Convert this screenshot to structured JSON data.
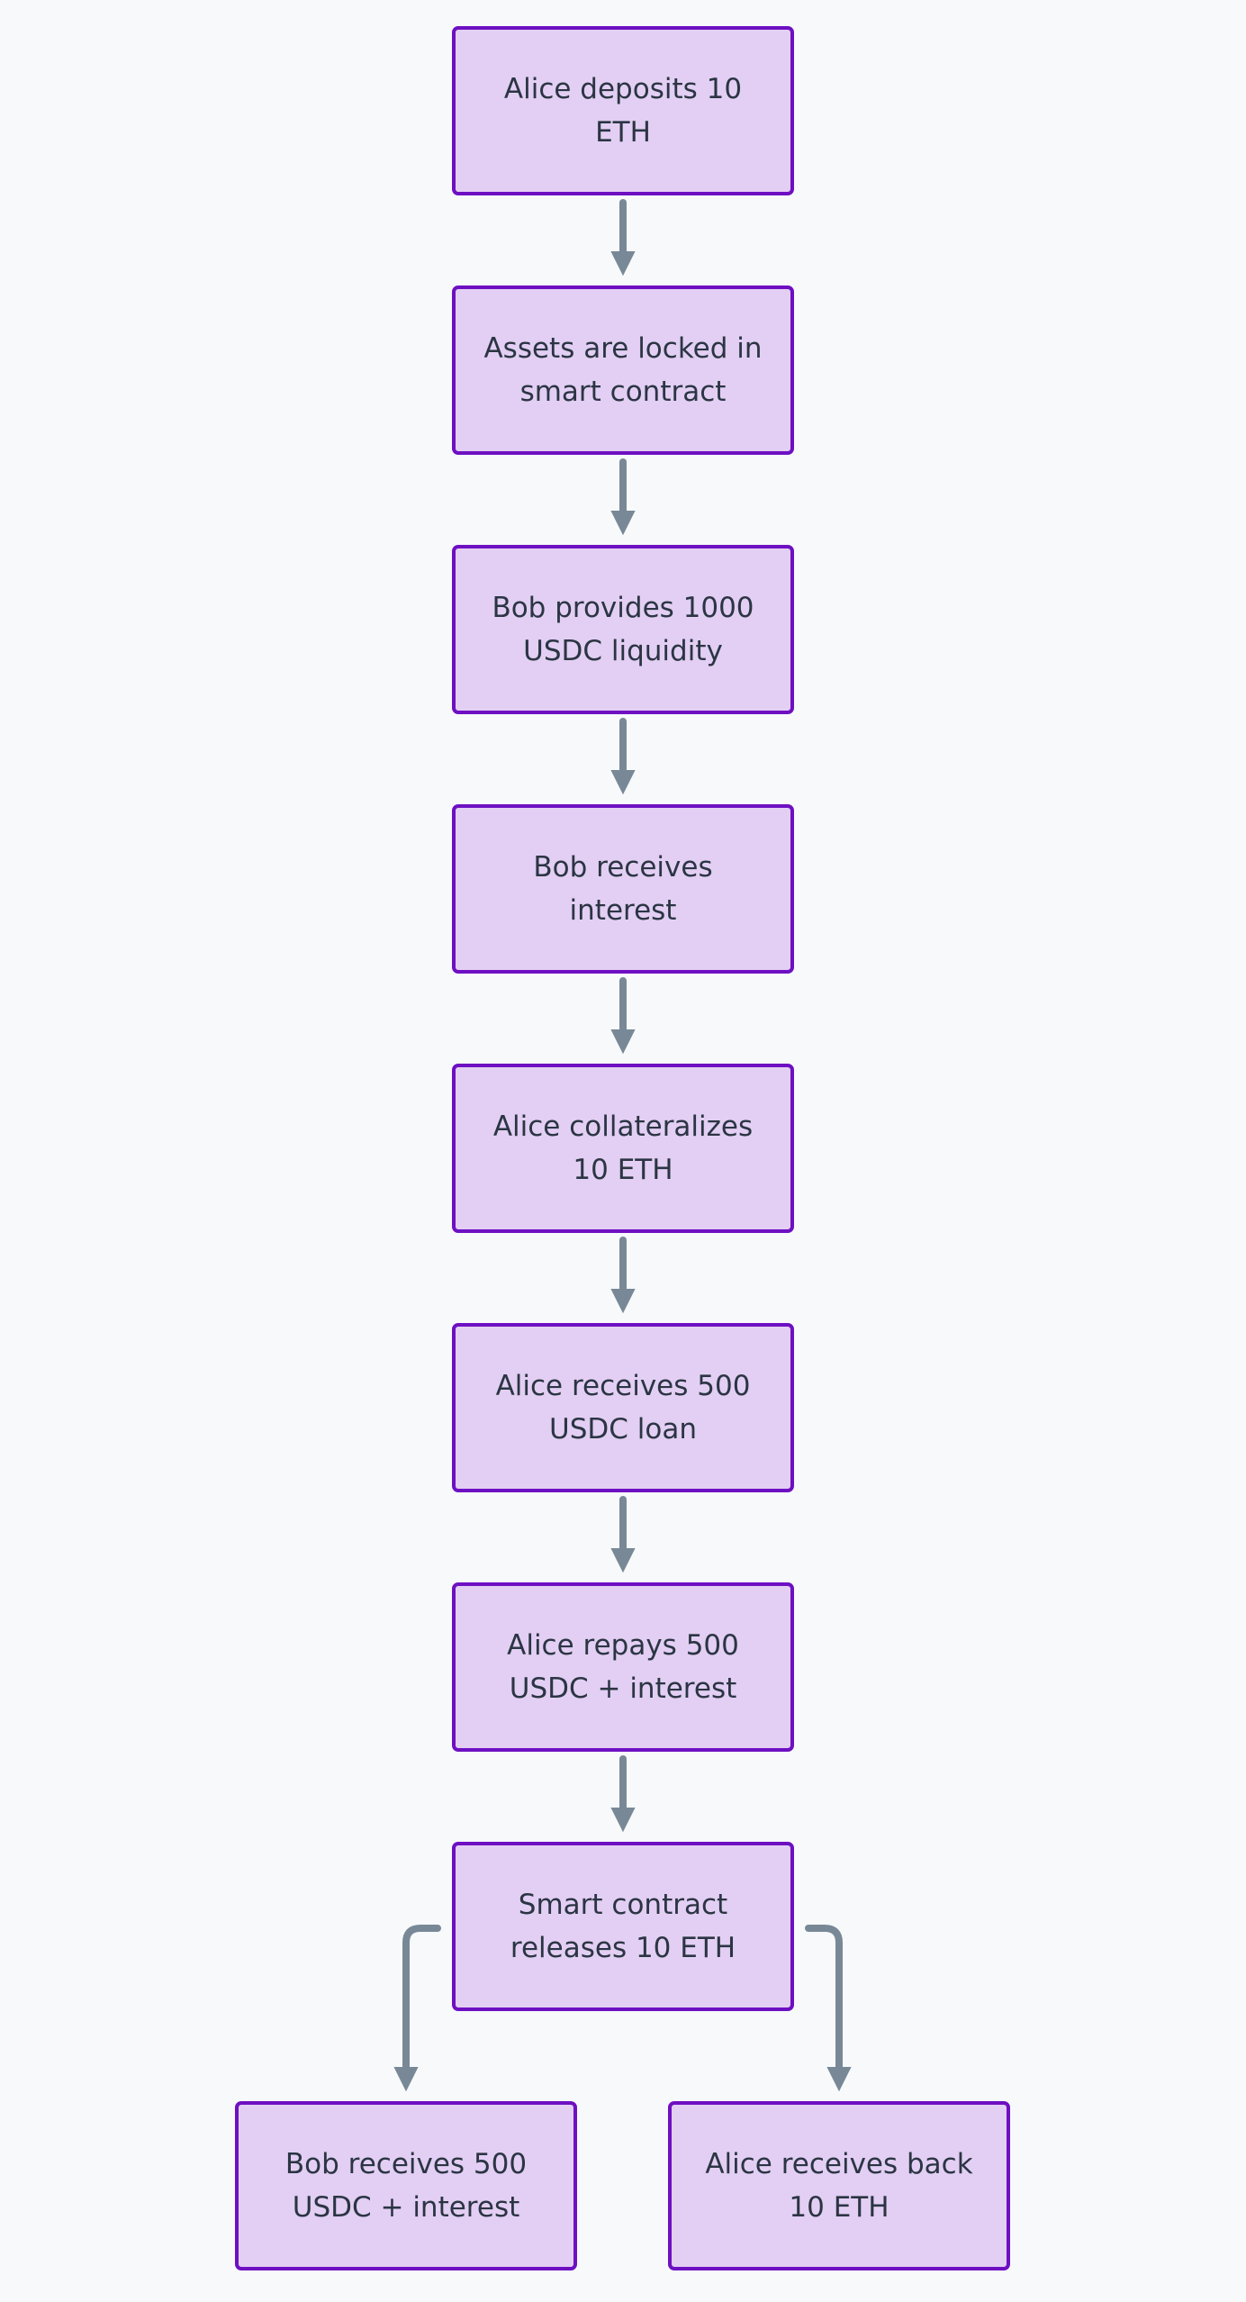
{
  "colors": {
    "background": "#f7f9fb",
    "node_fill": "#e3cff3",
    "node_border": "#6e10c2",
    "edge": "#788896",
    "text": "#2b3544"
  },
  "nodes": [
    {
      "id": "n1",
      "label": "Alice deposits 10 ETH"
    },
    {
      "id": "n2",
      "label": "Assets are locked in smart contract"
    },
    {
      "id": "n3",
      "label": "Bob provides 1000 USDC liquidity"
    },
    {
      "id": "n4",
      "label": "Bob receives interest"
    },
    {
      "id": "n5",
      "label": "Alice collateralizes 10 ETH"
    },
    {
      "id": "n6",
      "label": "Alice receives 500 USDC loan"
    },
    {
      "id": "n7",
      "label": "Alice repays 500 USDC + interest"
    },
    {
      "id": "n8",
      "label": "Smart contract releases 10 ETH"
    },
    {
      "id": "n9",
      "label": "Bob receives 500 USDC + interest"
    },
    {
      "id": "n10",
      "label": "Alice receives back 10 ETH"
    }
  ],
  "edges": [
    {
      "from": "n1",
      "to": "n2"
    },
    {
      "from": "n2",
      "to": "n3"
    },
    {
      "from": "n3",
      "to": "n4"
    },
    {
      "from": "n4",
      "to": "n5"
    },
    {
      "from": "n5",
      "to": "n6"
    },
    {
      "from": "n6",
      "to": "n7"
    },
    {
      "from": "n7",
      "to": "n8"
    },
    {
      "from": "n8",
      "to": "n9"
    },
    {
      "from": "n8",
      "to": "n10"
    }
  ]
}
